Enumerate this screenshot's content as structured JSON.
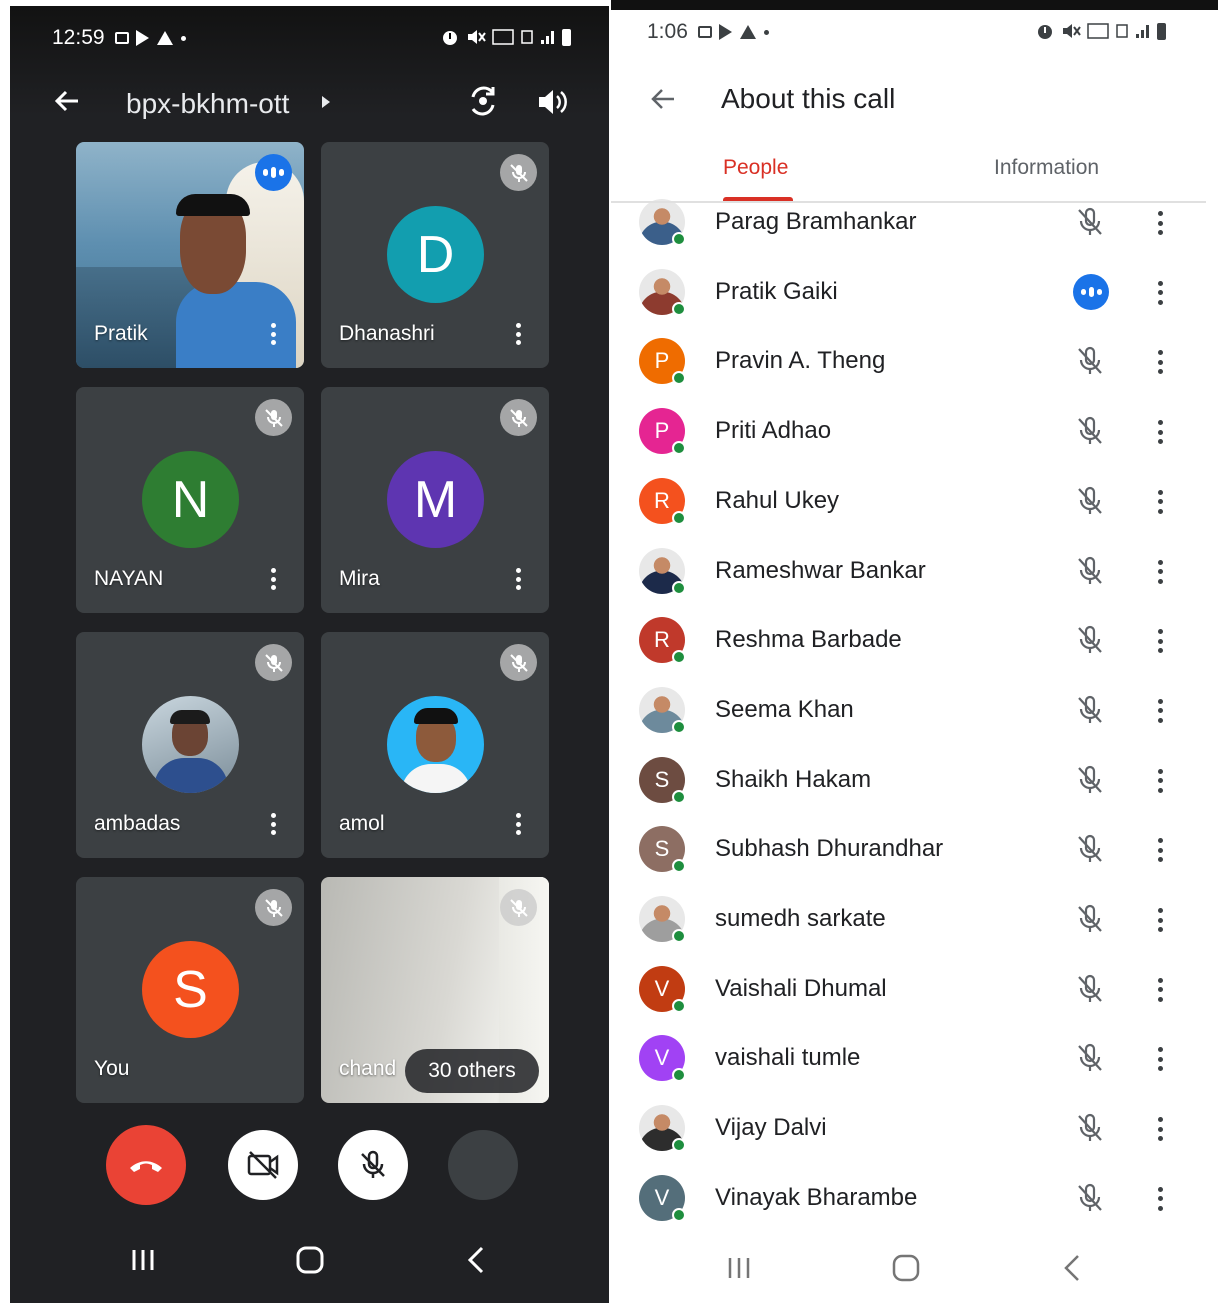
{
  "left_phone": {
    "status_time": "12:59",
    "meeting_code": "bpx-bkhm-ott",
    "tiles": [
      {
        "name": "Pratik",
        "type": "video",
        "state": "speaking"
      },
      {
        "name": "Dhanashri",
        "initial": "D",
        "color": "#129eaf",
        "state": "muted"
      },
      {
        "name": "NAYAN",
        "initial": "N",
        "color": "#2e7d32",
        "state": "muted"
      },
      {
        "name": "Mira",
        "initial": "M",
        "color": "#5e35b1",
        "state": "muted"
      },
      {
        "name": "ambadas",
        "type": "photo",
        "state": "muted"
      },
      {
        "name": "amol",
        "type": "photo",
        "state": "muted"
      },
      {
        "name": "You",
        "initial": "S",
        "color": "#f4511e",
        "state": "muted"
      },
      {
        "name": "chand",
        "type": "video",
        "state": "muted",
        "others_label": "30 others"
      }
    ],
    "controls": [
      "end-call",
      "camera-off",
      "mic-off",
      "more"
    ]
  },
  "right_phone": {
    "status_time": "1:06",
    "title": "About this call",
    "tabs": {
      "people": "People",
      "information": "Information"
    },
    "people": [
      {
        "name": "Parag Bramhankar",
        "avatar": "photo",
        "color": "#3b5f8a",
        "state": "muted"
      },
      {
        "name": "Pratik Gaiki",
        "avatar": "photo",
        "color": "#8d3b2f",
        "state": "speaking"
      },
      {
        "name": "Pravin A. Theng",
        "initial": "P",
        "color": "#ef6c00",
        "state": "muted"
      },
      {
        "name": "Priti Adhao",
        "initial": "P",
        "color": "#e52592",
        "state": "muted"
      },
      {
        "name": "Rahul Ukey",
        "initial": "R",
        "color": "#f4511e",
        "state": "muted"
      },
      {
        "name": "Rameshwar Bankar",
        "avatar": "photo",
        "color": "#1c2a4a",
        "state": "muted"
      },
      {
        "name": "Reshma Barbade",
        "initial": "R",
        "color": "#c0392b",
        "state": "muted"
      },
      {
        "name": "Seema Khan",
        "avatar": "photo",
        "color": "#6d8a9c",
        "state": "muted"
      },
      {
        "name": "Shaikh Hakam",
        "initial": "S",
        "color": "#6d4c41",
        "state": "muted"
      },
      {
        "name": "Subhash Dhurandhar",
        "initial": "S",
        "color": "#8d6e63",
        "state": "muted"
      },
      {
        "name": "sumedh sarkate",
        "avatar": "photo",
        "color": "#9e9e9e",
        "state": "muted"
      },
      {
        "name": "Vaishali Dhumal",
        "initial": "V",
        "color": "#c13c12",
        "state": "muted"
      },
      {
        "name": "vaishali tumle",
        "initial": "V",
        "color": "#a142f4",
        "state": "muted"
      },
      {
        "name": "Vijay Dalvi",
        "avatar": "photo",
        "color": "#2d2d2d",
        "state": "muted"
      },
      {
        "name": "Vinayak Bharambe",
        "initial": "V",
        "color": "#546e7a",
        "state": "muted"
      }
    ]
  }
}
